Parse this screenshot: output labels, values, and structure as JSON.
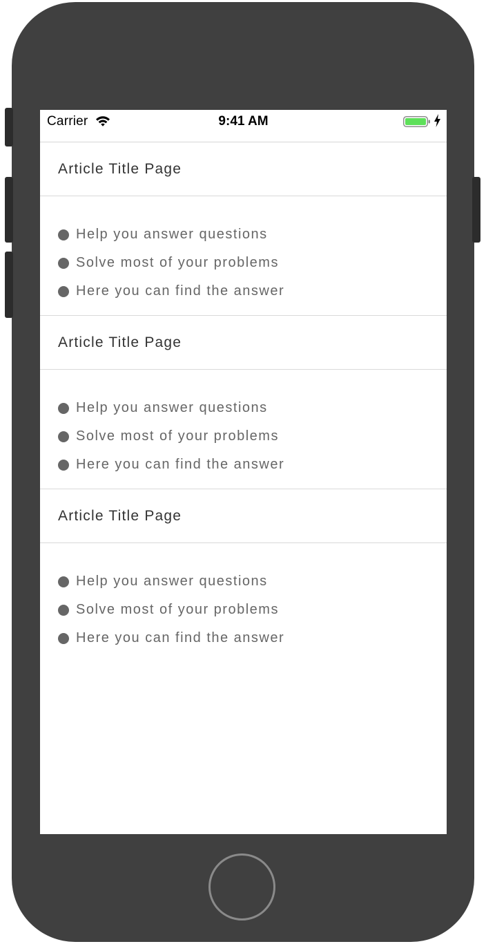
{
  "status_bar": {
    "carrier": "Carrier",
    "time": "9:41 AM",
    "wifi_icon": "wifi-icon",
    "battery_icon": "battery-charging-icon",
    "battery_color": "#5ee05a"
  },
  "sections": [
    {
      "title": "Article Title Page",
      "items": [
        "Help you answer questions",
        "Solve most of your problems",
        "Here you can find the answer"
      ]
    },
    {
      "title": "Article Title Page",
      "items": [
        "Help you answer questions",
        "Solve most of your problems",
        "Here you can find the answer"
      ]
    },
    {
      "title": "Article Title Page",
      "items": [
        "Help you answer questions",
        "Solve most of your problems",
        "Here you can find the answer"
      ]
    }
  ],
  "colors": {
    "device_frame": "#404040",
    "title_text": "#333333",
    "body_text": "#666666",
    "divider": "#d9d9d9"
  }
}
